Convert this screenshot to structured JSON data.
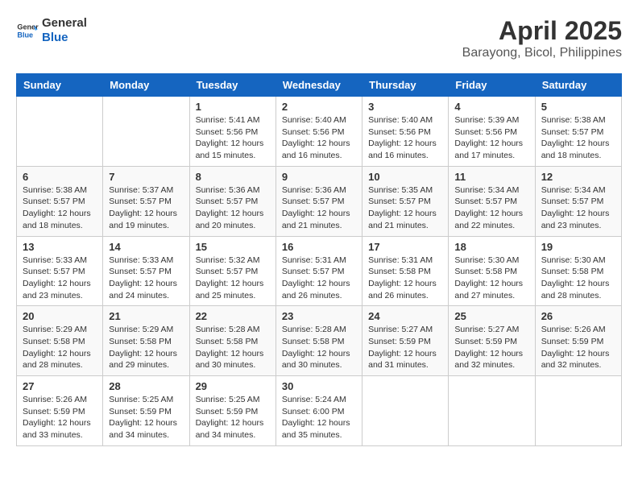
{
  "header": {
    "logo_line1": "General",
    "logo_line2": "Blue",
    "title": "April 2025",
    "subtitle": "Barayong, Bicol, Philippines"
  },
  "calendar": {
    "days_of_week": [
      "Sunday",
      "Monday",
      "Tuesday",
      "Wednesday",
      "Thursday",
      "Friday",
      "Saturday"
    ],
    "weeks": [
      [
        {
          "day": "",
          "sunrise": "",
          "sunset": "",
          "daylight": ""
        },
        {
          "day": "",
          "sunrise": "",
          "sunset": "",
          "daylight": ""
        },
        {
          "day": "1",
          "sunrise": "Sunrise: 5:41 AM",
          "sunset": "Sunset: 5:56 PM",
          "daylight": "Daylight: 12 hours and 15 minutes."
        },
        {
          "day": "2",
          "sunrise": "Sunrise: 5:40 AM",
          "sunset": "Sunset: 5:56 PM",
          "daylight": "Daylight: 12 hours and 16 minutes."
        },
        {
          "day": "3",
          "sunrise": "Sunrise: 5:40 AM",
          "sunset": "Sunset: 5:56 PM",
          "daylight": "Daylight: 12 hours and 16 minutes."
        },
        {
          "day": "4",
          "sunrise": "Sunrise: 5:39 AM",
          "sunset": "Sunset: 5:56 PM",
          "daylight": "Daylight: 12 hours and 17 minutes."
        },
        {
          "day": "5",
          "sunrise": "Sunrise: 5:38 AM",
          "sunset": "Sunset: 5:57 PM",
          "daylight": "Daylight: 12 hours and 18 minutes."
        }
      ],
      [
        {
          "day": "6",
          "sunrise": "Sunrise: 5:38 AM",
          "sunset": "Sunset: 5:57 PM",
          "daylight": "Daylight: 12 hours and 18 minutes."
        },
        {
          "day": "7",
          "sunrise": "Sunrise: 5:37 AM",
          "sunset": "Sunset: 5:57 PM",
          "daylight": "Daylight: 12 hours and 19 minutes."
        },
        {
          "day": "8",
          "sunrise": "Sunrise: 5:36 AM",
          "sunset": "Sunset: 5:57 PM",
          "daylight": "Daylight: 12 hours and 20 minutes."
        },
        {
          "day": "9",
          "sunrise": "Sunrise: 5:36 AM",
          "sunset": "Sunset: 5:57 PM",
          "daylight": "Daylight: 12 hours and 21 minutes."
        },
        {
          "day": "10",
          "sunrise": "Sunrise: 5:35 AM",
          "sunset": "Sunset: 5:57 PM",
          "daylight": "Daylight: 12 hours and 21 minutes."
        },
        {
          "day": "11",
          "sunrise": "Sunrise: 5:34 AM",
          "sunset": "Sunset: 5:57 PM",
          "daylight": "Daylight: 12 hours and 22 minutes."
        },
        {
          "day": "12",
          "sunrise": "Sunrise: 5:34 AM",
          "sunset": "Sunset: 5:57 PM",
          "daylight": "Daylight: 12 hours and 23 minutes."
        }
      ],
      [
        {
          "day": "13",
          "sunrise": "Sunrise: 5:33 AM",
          "sunset": "Sunset: 5:57 PM",
          "daylight": "Daylight: 12 hours and 23 minutes."
        },
        {
          "day": "14",
          "sunrise": "Sunrise: 5:33 AM",
          "sunset": "Sunset: 5:57 PM",
          "daylight": "Daylight: 12 hours and 24 minutes."
        },
        {
          "day": "15",
          "sunrise": "Sunrise: 5:32 AM",
          "sunset": "Sunset: 5:57 PM",
          "daylight": "Daylight: 12 hours and 25 minutes."
        },
        {
          "day": "16",
          "sunrise": "Sunrise: 5:31 AM",
          "sunset": "Sunset: 5:57 PM",
          "daylight": "Daylight: 12 hours and 26 minutes."
        },
        {
          "day": "17",
          "sunrise": "Sunrise: 5:31 AM",
          "sunset": "Sunset: 5:58 PM",
          "daylight": "Daylight: 12 hours and 26 minutes."
        },
        {
          "day": "18",
          "sunrise": "Sunrise: 5:30 AM",
          "sunset": "Sunset: 5:58 PM",
          "daylight": "Daylight: 12 hours and 27 minutes."
        },
        {
          "day": "19",
          "sunrise": "Sunrise: 5:30 AM",
          "sunset": "Sunset: 5:58 PM",
          "daylight": "Daylight: 12 hours and 28 minutes."
        }
      ],
      [
        {
          "day": "20",
          "sunrise": "Sunrise: 5:29 AM",
          "sunset": "Sunset: 5:58 PM",
          "daylight": "Daylight: 12 hours and 28 minutes."
        },
        {
          "day": "21",
          "sunrise": "Sunrise: 5:29 AM",
          "sunset": "Sunset: 5:58 PM",
          "daylight": "Daylight: 12 hours and 29 minutes."
        },
        {
          "day": "22",
          "sunrise": "Sunrise: 5:28 AM",
          "sunset": "Sunset: 5:58 PM",
          "daylight": "Daylight: 12 hours and 30 minutes."
        },
        {
          "day": "23",
          "sunrise": "Sunrise: 5:28 AM",
          "sunset": "Sunset: 5:58 PM",
          "daylight": "Daylight: 12 hours and 30 minutes."
        },
        {
          "day": "24",
          "sunrise": "Sunrise: 5:27 AM",
          "sunset": "Sunset: 5:59 PM",
          "daylight": "Daylight: 12 hours and 31 minutes."
        },
        {
          "day": "25",
          "sunrise": "Sunrise: 5:27 AM",
          "sunset": "Sunset: 5:59 PM",
          "daylight": "Daylight: 12 hours and 32 minutes."
        },
        {
          "day": "26",
          "sunrise": "Sunrise: 5:26 AM",
          "sunset": "Sunset: 5:59 PM",
          "daylight": "Daylight: 12 hours and 32 minutes."
        }
      ],
      [
        {
          "day": "27",
          "sunrise": "Sunrise: 5:26 AM",
          "sunset": "Sunset: 5:59 PM",
          "daylight": "Daylight: 12 hours and 33 minutes."
        },
        {
          "day": "28",
          "sunrise": "Sunrise: 5:25 AM",
          "sunset": "Sunset: 5:59 PM",
          "daylight": "Daylight: 12 hours and 34 minutes."
        },
        {
          "day": "29",
          "sunrise": "Sunrise: 5:25 AM",
          "sunset": "Sunset: 5:59 PM",
          "daylight": "Daylight: 12 hours and 34 minutes."
        },
        {
          "day": "30",
          "sunrise": "Sunrise: 5:24 AM",
          "sunset": "Sunset: 6:00 PM",
          "daylight": "Daylight: 12 hours and 35 minutes."
        },
        {
          "day": "",
          "sunrise": "",
          "sunset": "",
          "daylight": ""
        },
        {
          "day": "",
          "sunrise": "",
          "sunset": "",
          "daylight": ""
        },
        {
          "day": "",
          "sunrise": "",
          "sunset": "",
          "daylight": ""
        }
      ]
    ]
  }
}
